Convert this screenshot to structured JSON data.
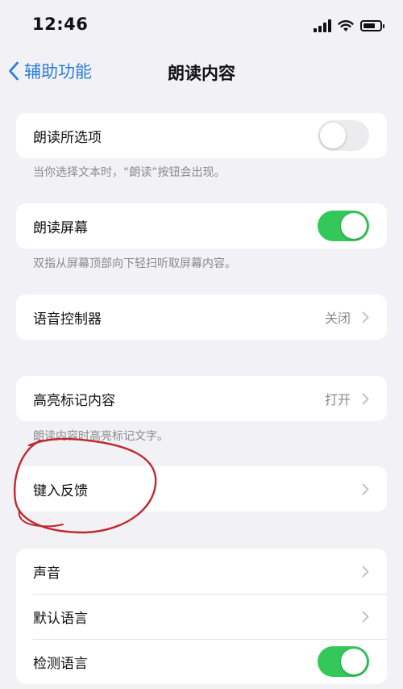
{
  "status_bar": {
    "time": "12:46"
  },
  "nav": {
    "back_label": "辅助功能",
    "title": "朗读内容"
  },
  "speak_selection": {
    "label": "朗读所选项",
    "toggle": "off",
    "footnote": "当你选择文本时，“朗读”按钮会出现。"
  },
  "speak_screen": {
    "label": "朗读屏幕",
    "toggle": "on",
    "footnote": "双指从屏幕顶部向下轻扫听取屏幕内容。"
  },
  "speech_controller": {
    "label": "语音控制器",
    "value": "关闭"
  },
  "highlight_content": {
    "label": "高亮标记内容",
    "value": "打开",
    "footnote": "朗读内容时高亮标记文字。"
  },
  "typing_feedback": {
    "label": "键入反馈"
  },
  "voices": {
    "label": "声音"
  },
  "default_language": {
    "label": "默认语言"
  },
  "detect_language": {
    "label": "检测语言",
    "toggle": "on"
  },
  "colors": {
    "accent": "#2a7de1",
    "toggle_on": "#34c759",
    "annotation": "#c0282e"
  }
}
